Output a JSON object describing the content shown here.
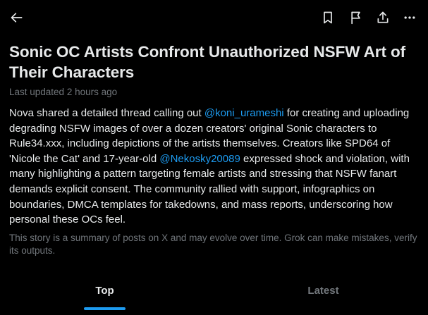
{
  "header": {
    "back_icon": "arrow-left-icon",
    "bookmark_icon": "bookmark-icon",
    "report_icon": "flag-icon",
    "share_icon": "share-icon",
    "more_icon": "more-horizontal-icon"
  },
  "story": {
    "title": "Sonic OC Artists Confront Unauthorized NSFW Art of Their Characters",
    "updated": "Last updated 2 hours ago",
    "body": {
      "p1": "Nova shared a detailed thread calling out ",
      "mention1": "@koni_urameshi",
      "p2": " for creating and uploading degrading NSFW images of over a dozen creators' original Sonic characters to Rule34.xxx, including depictions of the artists themselves. Creators like SPD64 of 'Nicole the Cat' and 17-year-old ",
      "mention2": "@Nekosky20089",
      "p3": " expressed shock and violation, with many highlighting a pattern targeting female artists and stressing that NSFW fanart demands explicit consent. The community rallied with support, infographics on boundaries, DMCA templates for takedowns, and mass reports, underscoring how personal these OCs feel."
    },
    "disclaimer": "This story is a summary of posts on X and may evolve over time. Grok can make mistakes, verify its outputs."
  },
  "tabs": {
    "top": "Top",
    "latest": "Latest",
    "active": "Top"
  },
  "colors": {
    "background": "#000000",
    "text": "#e7e9ea",
    "secondary": "#71767b",
    "accent": "#1d9bf0"
  }
}
